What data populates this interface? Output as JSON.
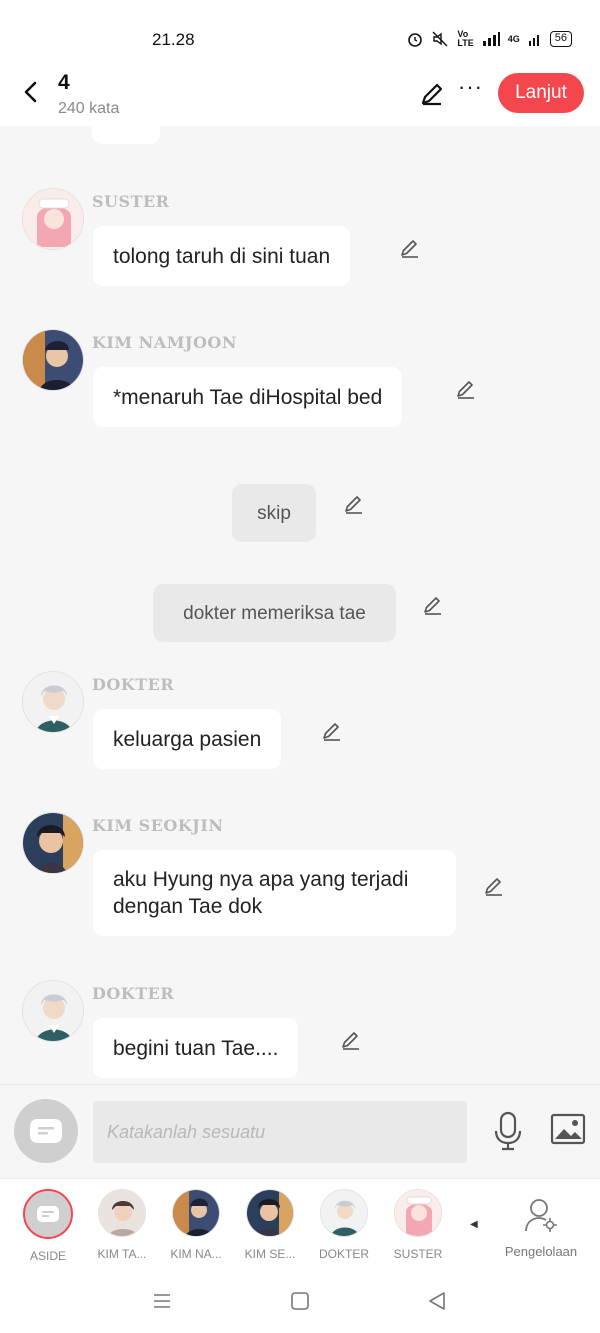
{
  "status_bar": {
    "time": "21.28",
    "battery": "56",
    "network": "4G"
  },
  "header": {
    "title": "4",
    "word_count": "240 kata",
    "next_button": "Lanjut"
  },
  "messages": [
    {
      "type": "character",
      "name": "SUSTER",
      "text": "tolong taruh di sini tuan",
      "avatar": "nurse"
    },
    {
      "type": "character",
      "name": "KIM NAMJOON",
      "text": "*menaruh Tae diHospital bed",
      "avatar": "namjoon"
    },
    {
      "type": "aside",
      "text": "skip"
    },
    {
      "type": "aside",
      "text": "dokter memeriksa tae"
    },
    {
      "type": "character",
      "name": "DOKTER",
      "text": "keluarga pasien",
      "avatar": "doctor"
    },
    {
      "type": "character",
      "name": "KIM SEOKJIN",
      "text": "aku Hyung nya apa yang terjadi dengan Tae dok",
      "avatar": "seokjin"
    },
    {
      "type": "character",
      "name": "DOKTER",
      "text": "begini tuan Tae....",
      "avatar": "doctor"
    }
  ],
  "input": {
    "placeholder": "Katakanlah sesuatu"
  },
  "characters": [
    {
      "label": "ASIDE"
    },
    {
      "label": "KIM TA..."
    },
    {
      "label": "KIM NA..."
    },
    {
      "label": "KIM SE..."
    },
    {
      "label": "DOKTER"
    },
    {
      "label": "SUSTER"
    }
  ],
  "management": {
    "label": "Pengelolaan"
  },
  "colors": {
    "accent": "#f4474d",
    "background": "#f6f6f6",
    "bubble": "#ffffff",
    "aside_bubble": "#e9e9e9"
  }
}
